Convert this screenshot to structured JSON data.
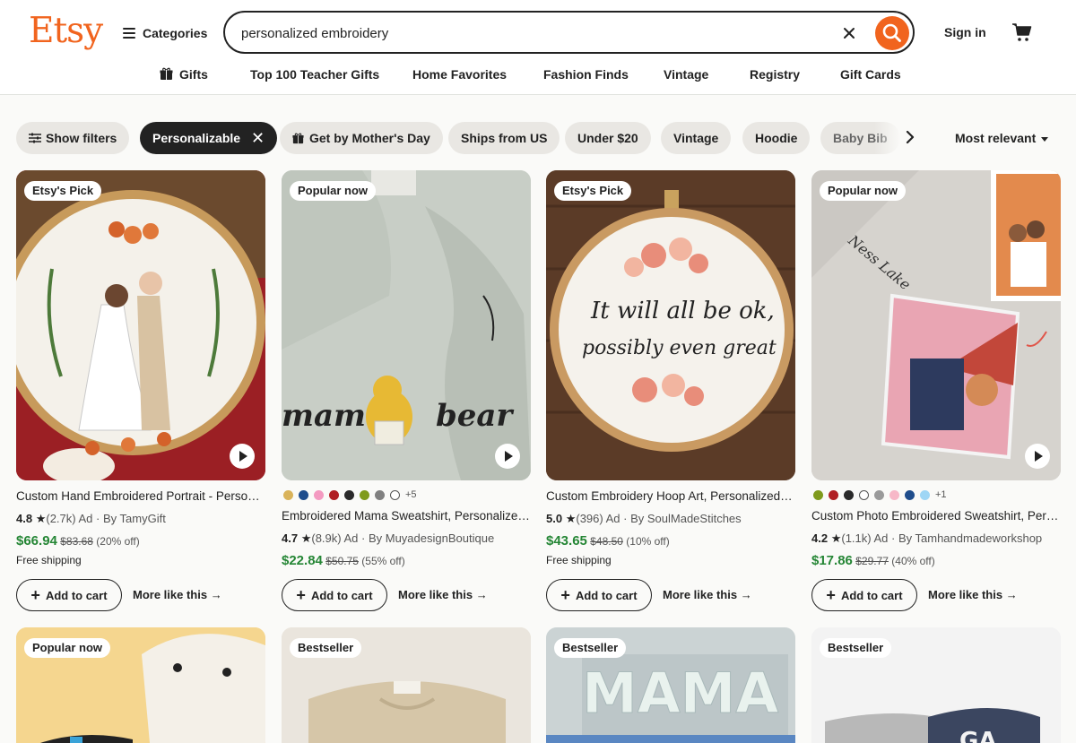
{
  "app": {
    "logo": "Etsy",
    "categories_label": "Categories",
    "sign_in_label": "Sign in",
    "brand_color": "#f1641e"
  },
  "search": {
    "value": "personalized embroidery",
    "clear_icon": "close-icon",
    "submit_icon": "search-icon"
  },
  "nav": {
    "items": [
      "Gifts",
      "Top 100 Teacher Gifts",
      "Home Favorites",
      "Fashion Finds",
      "Vintage",
      "Registry",
      "Gift Cards"
    ]
  },
  "filters": {
    "show_filters": "Show filters",
    "active": "Personalizable",
    "chips": [
      "Get by Mother's Day",
      "Ships from US",
      "Under $20",
      "Vintage",
      "Hoodie",
      "Baby Bib"
    ],
    "sort": "Most relevant"
  },
  "products": [
    {
      "badge": "Etsy's Pick",
      "title": "Custom Hand Embroidered Portrait - Personalized Wedding Hoop",
      "rating": "4.8",
      "reviews": "(2.7k)",
      "ad": "Ad",
      "seller": "By TamyGift",
      "price": "$66.94",
      "original_price": "$83.68",
      "discount": "(20% off)",
      "shipping": "Free shipping",
      "has_video": true
    },
    {
      "badge": "Popular now",
      "title": "Embroidered Mama Sweatshirt, Personalized Mama Bear Crewneck",
      "swatches": [
        "#d9b35a",
        "#1f4d8c",
        "#f49ac1",
        "#b01e23",
        "#2a2a2a",
        "#7f9a1c",
        "#808080",
        "#ffffff"
      ],
      "swatch_more": "+5",
      "rating": "4.7",
      "reviews": "(8.9k)",
      "ad": "Ad",
      "seller": "By MuyadesignBoutique",
      "price": "$22.84",
      "original_price": "$50.75",
      "discount": "(55% off)",
      "has_video": true
    },
    {
      "badge": "Etsy's Pick",
      "title": "Custom Embroidery Hoop Art, Personalized Quote Hoop",
      "rating": "5.0",
      "reviews": "(396)",
      "ad": "Ad",
      "seller": "By SoulMadeStitches",
      "price": "$43.65",
      "original_price": "$48.50",
      "discount": "(10% off)",
      "shipping": "Free shipping",
      "has_video": false
    },
    {
      "badge": "Popular now",
      "title": "Custom Photo Embroidered Sweatshirt, Personalized Photo Hoodie",
      "swatches": [
        "#7f9a1c",
        "#b01e23",
        "#2a2a2a",
        "#ffffff",
        "#9a9a9a",
        "#f7b8c8",
        "#1f4d8c",
        "#9fd6f5"
      ],
      "swatch_more": "+1",
      "rating": "4.2",
      "reviews": "(1.1k)",
      "ad": "Ad",
      "seller": "By Tamhandmadeworkshop",
      "price": "$17.86",
      "original_price": "$29.77",
      "discount": "(40% off)",
      "has_video": true
    }
  ],
  "actions": {
    "add_to_cart": "Add to cart",
    "more_like_this": "More like this"
  },
  "row2_badges": [
    "Popular now",
    "Bestseller",
    "Bestseller",
    "Bestseller"
  ]
}
